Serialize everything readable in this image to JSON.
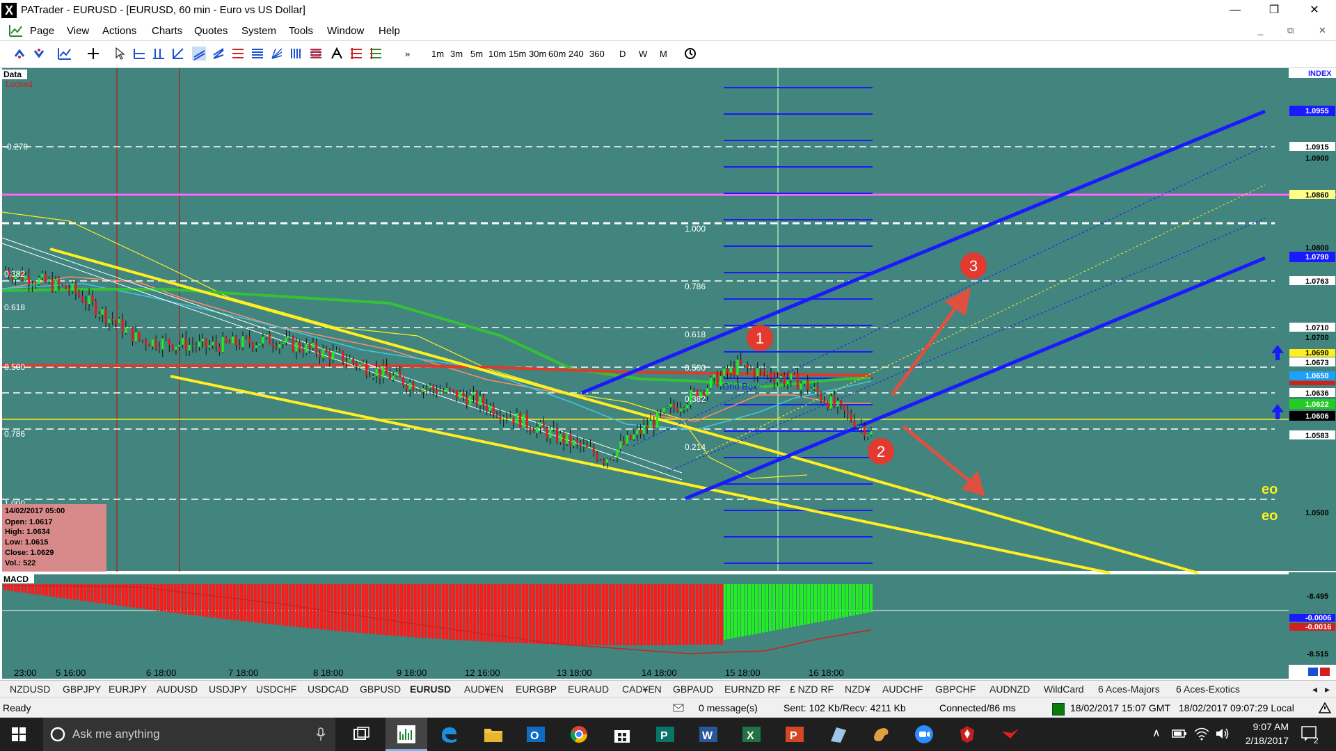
{
  "window": {
    "title": "PATrader - EURUSD - [EURUSD, 60 min - Euro vs US Dollar]",
    "app_icon": "X",
    "minimize": "—",
    "restore": "❐",
    "close": "✕"
  },
  "menu": {
    "items": [
      "Page",
      "View",
      "Actions",
      "Charts",
      "Quotes",
      "System",
      "Tools",
      "Window",
      "Help"
    ],
    "mdi_min": "_",
    "mdi_restore": "⧉",
    "mdi_close": "✕"
  },
  "toolbar": {
    "more": "»",
    "timeframes": [
      "1m",
      "3m",
      "5m",
      "10m",
      "15m",
      "30m",
      "60m",
      "240",
      "360",
      "D",
      "W",
      "M"
    ]
  },
  "chart": {
    "data_label": "Data",
    "locked_label": "Locked",
    "index_label": "INDEX",
    "grid_label": "Grid Box",
    "ohlc": {
      "date": "14/02/2017 05:00",
      "open": "Open: 1.0617",
      "high": "High: 1.0634",
      "low": "Low: 1.0615",
      "close": "Close: 1.0629",
      "vol": "Vol.: 522"
    },
    "left_fib_labels": [
      "-0.270",
      "0.382",
      "0.500",
      "0.618",
      "0.786",
      "1.000"
    ],
    "mid_fib_labels": [
      "1.000",
      "0.786",
      "0.618",
      "0.500",
      "0.382",
      "0.214"
    ],
    "price_labels": [
      "1.0955",
      "1.0915",
      "1.0900",
      "1.0860",
      "1.0800",
      "1.0790",
      "1.0763",
      "1.0710",
      "1.0700",
      "1.0690",
      "1.0673",
      "1.0650",
      "1.0636",
      "1.0622",
      "1.0606",
      "1.0583",
      "1.0500"
    ],
    "markers": [
      "1",
      "2",
      "3"
    ],
    "eo_labels": [
      "eo",
      "eo"
    ],
    "macd_label": "MACD",
    "macd_scale": [
      "-8.495",
      "-0.0006",
      "-0.0016",
      "-8.515"
    ],
    "time_labels": [
      "23:00",
      "5 16:00",
      "6 18:00",
      "7 18:00",
      "8 18:00",
      "9 18:00",
      "12 16:00",
      "13 18:00",
      "14 18:00",
      "15 18:00",
      "16 18:00"
    ]
  },
  "tabs": [
    "NZDUSD",
    "GBPJPY",
    "EURJPY",
    "AUDUSD",
    "USDJPY",
    "USDCHF",
    "USDCAD",
    "GBPUSD",
    "EURUSD",
    "AUD¥EN",
    "EURGBP",
    "EURAUD",
    "CAD¥EN",
    "GBPAUD",
    "EURNZD RF",
    "£ NZD RF",
    "NZD¥",
    "AUDCHF",
    "GBPCHF",
    "AUDNZD",
    "WildCard",
    "6 Aces-Majors",
    "6 Aces-Exotics"
  ],
  "active_tab": "EURUSD",
  "status": {
    "ready": "Ready",
    "messages": "0 message(s)",
    "traffic": "Sent: 102 Kb/Recv: 4211 Kb",
    "connected": "Connected/86 ms",
    "gmt": "18/02/2017 15:07 GMT",
    "local": "18/02/2017 09:07:29 Local"
  },
  "taskbar": {
    "search_placeholder": "Ask me anything",
    "time": "9:07 AM",
    "date": "2/18/2017",
    "notifications": "2"
  },
  "colors": {
    "chart_bg": "#42847e",
    "upper_channel": "#1a1aff",
    "lower_channel": "#ffee22",
    "fib_magenta": "#ff66ff",
    "marker": "#e23a2e",
    "macd_neg": "#ff1a1a",
    "macd_pos": "#22ee22"
  },
  "chart_data": {
    "type": "candlestick",
    "symbol": "EURUSD",
    "timeframe": "60 min",
    "y_range": [
      1.047,
      1.098
    ],
    "x_labels": [
      "23:00",
      "5 16:00",
      "6 18:00",
      "7 18:00",
      "8 18:00",
      "9 18:00",
      "12 16:00",
      "13 18:00",
      "14 18:00",
      "15 18:00",
      "16 18:00"
    ],
    "approx_close": [
      1.0775,
      1.0755,
      1.0705,
      1.0698,
      1.0705,
      1.0688,
      1.0662,
      1.0645,
      1.0615,
      1.0585,
      1.0635,
      1.0678,
      1.066,
      1.061
    ],
    "fib_levels_left": [
      -0.27,
      0.382,
      0.5,
      0.618,
      0.786,
      1.0
    ],
    "fib_levels_mid": [
      1.0,
      0.786,
      0.618,
      0.5,
      0.382,
      0.214
    ],
    "labelled_prices": [
      1.0955,
      1.0915,
      1.086,
      1.079,
      1.0763,
      1.071,
      1.0673,
      1.0636,
      1.0622,
      1.0606,
      1.0583,
      1.05
    ]
  }
}
